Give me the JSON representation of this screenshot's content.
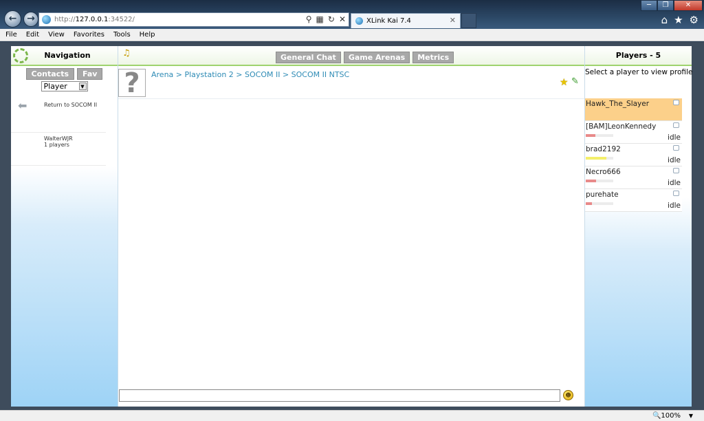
{
  "browser": {
    "url_prefix": "http://",
    "url_host": "127.0.0.1",
    "url_port": ":34522/",
    "tab_title": "XLink Kai 7.4",
    "menu": [
      "File",
      "Edit",
      "View",
      "Favorites",
      "Tools",
      "Help"
    ],
    "zoom": "100%"
  },
  "navigation": {
    "title": "Navigation",
    "tabs": [
      "Contacts",
      "Fav"
    ],
    "select_value": "Player",
    "items": [
      {
        "label": "Return to SOCOM II"
      }
    ],
    "user": {
      "name": "WalterWJR",
      "players": "1 players"
    }
  },
  "center": {
    "tabs": [
      "General Chat",
      "Game Arenas",
      "Metrics"
    ],
    "breadcrumb": "Arena > Playstation 2 > SOCOM II > SOCOM II NTSC",
    "game_pic_glyph": "?"
  },
  "players": {
    "title": "Players - 5",
    "hint": "Select a player to view profile",
    "list": [
      {
        "name": "Hawk_The_Slayer",
        "status": "",
        "bar": 0,
        "bar_color": "#f0a0a0",
        "selected": true
      },
      {
        "name": "[BAM]LeonKennedy",
        "status": "idle",
        "bar": 0.35,
        "bar_color": "#e88a8a",
        "selected": false
      },
      {
        "name": "brad2192",
        "status": "idle",
        "bar": 0.75,
        "bar_color": "#f4ef6a",
        "selected": false
      },
      {
        "name": "Necro666",
        "status": "idle",
        "bar": 0.38,
        "bar_color": "#e88a8a",
        "selected": false
      },
      {
        "name": "purehate",
        "status": "idle",
        "bar": 0.22,
        "bar_color": "#e88a8a",
        "selected": false
      }
    ]
  }
}
